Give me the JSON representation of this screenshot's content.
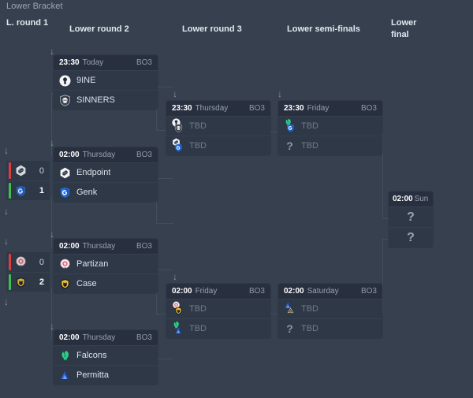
{
  "bracket": {
    "title": "Lower Bracket"
  },
  "rounds": [
    {
      "id": "r1",
      "label": "L. round 1"
    },
    {
      "id": "r2",
      "label": "Lower round 2"
    },
    {
      "id": "r3",
      "label": "Lower round 3"
    },
    {
      "id": "r4",
      "label": "Lower semi-finals"
    },
    {
      "id": "r5",
      "label": "Lower final"
    }
  ],
  "results": [
    {
      "id": "res-endpoint-genk",
      "rows": [
        {
          "team": "Endpoint",
          "score": "0",
          "outcome": "loss",
          "logo": "endpoint"
        },
        {
          "team": "Genk",
          "score": "1",
          "outcome": "win",
          "logo": "genk"
        }
      ]
    },
    {
      "id": "res-partizan-case",
      "rows": [
        {
          "team": "Partizan",
          "score": "0",
          "outcome": "loss",
          "logo": "partizan"
        },
        {
          "team": "Case",
          "score": "2",
          "outcome": "win",
          "logo": "case"
        }
      ]
    }
  ],
  "matches": [
    {
      "id": "m-9ine-sinners",
      "time": "23:30",
      "day": "Today",
      "format": "BO3",
      "teams": [
        {
          "name": "9INE",
          "logo": "nine",
          "tbd": false
        },
        {
          "name": "SINNERS",
          "logo": "sinners",
          "tbd": false
        }
      ]
    },
    {
      "id": "m-endpoint-genk",
      "time": "02:00",
      "day": "Thursday",
      "format": "BO3",
      "teams": [
        {
          "name": "Endpoint",
          "logo": "endpoint",
          "tbd": false
        },
        {
          "name": "Genk",
          "logo": "genk",
          "tbd": false
        }
      ]
    },
    {
      "id": "m-partizan-case",
      "time": "02:00",
      "day": "Thursday",
      "format": "BO3",
      "teams": [
        {
          "name": "Partizan",
          "logo": "partizan",
          "tbd": false
        },
        {
          "name": "Case",
          "logo": "case",
          "tbd": false
        }
      ]
    },
    {
      "id": "m-falcons-permitta",
      "time": "02:00",
      "day": "Thursday",
      "format": "BO3",
      "teams": [
        {
          "name": "Falcons",
          "logo": "falcons",
          "tbd": false
        },
        {
          "name": "Permitta",
          "logo": "permitta",
          "tbd": false
        }
      ]
    },
    {
      "id": "m-lr3-top",
      "time": "23:30",
      "day": "Thursday",
      "format": "BO3",
      "teams": [
        {
          "name": "TBD",
          "tbd": true,
          "candidates": [
            "nine",
            "sinners"
          ]
        },
        {
          "name": "TBD",
          "tbd": true,
          "candidates": [
            "endpoint",
            "genk"
          ]
        }
      ]
    },
    {
      "id": "m-lr3-bottom",
      "time": "02:00",
      "day": "Friday",
      "format": "BO3",
      "teams": [
        {
          "name": "TBD",
          "tbd": true,
          "candidates": [
            "partizan",
            "case"
          ]
        },
        {
          "name": "TBD",
          "tbd": true,
          "candidates": [
            "falcons",
            "permitta"
          ]
        }
      ]
    },
    {
      "id": "m-lsf-top",
      "time": "23:30",
      "day": "Friday",
      "format": "BO3",
      "teams": [
        {
          "name": "TBD",
          "tbd": true,
          "candidates": [
            "falcons",
            "genk"
          ]
        },
        {
          "name": "TBD",
          "tbd": true,
          "unknown": true
        }
      ]
    },
    {
      "id": "m-lsf-bottom",
      "time": "02:00",
      "day": "Saturday",
      "format": "BO3",
      "teams": [
        {
          "name": "TBD",
          "tbd": true,
          "candidates": [
            "permitta",
            "endpoint_red"
          ]
        },
        {
          "name": "TBD",
          "tbd": true,
          "unknown": true
        }
      ]
    }
  ],
  "final": {
    "id": "m-lower-final",
    "time": "02:00",
    "day": "Sun",
    "slots": [
      {
        "name": "?",
        "unknown": true
      },
      {
        "name": "?",
        "unknown": true
      }
    ]
  },
  "colors": {
    "background": "#36404f",
    "card": "#2f3847",
    "card_header": "#283040",
    "win": "#3fbf4f",
    "loss": "#e23b3b",
    "text": "#dbe2ec",
    "muted": "#6f7b8c",
    "connector": "#424d5e"
  }
}
